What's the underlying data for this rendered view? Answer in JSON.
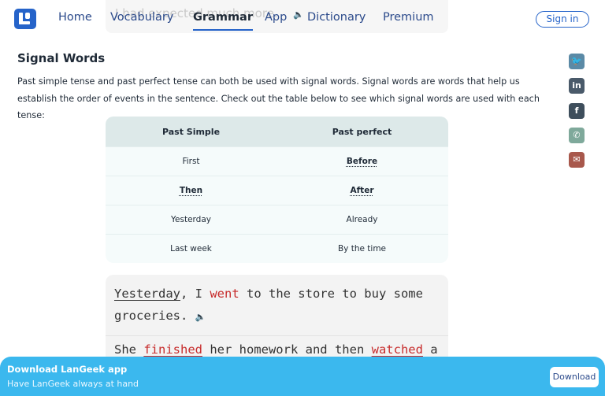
{
  "header": {
    "nav": [
      "Home",
      "Vocabulary",
      "Grammar",
      "App",
      "Dictionary",
      "Premium"
    ],
    "active": "Grammar",
    "faded_sentence": "I had expected much more.",
    "signin": "Sign in"
  },
  "section": {
    "title": "Signal Words",
    "paragraph": "Past simple tense and past perfect tense can both be used with signal words. Signal words are words that help us establish the order of events in the sentence. Check out the table below to see which signal words are used with each tense:"
  },
  "table": {
    "headers": [
      "Past Simple",
      "Past perfect"
    ],
    "rows": [
      [
        "First",
        "Before"
      ],
      [
        "Then",
        "After"
      ],
      [
        "Yesterday",
        "Already"
      ],
      [
        "Last week",
        "By the time"
      ]
    ]
  },
  "example": {
    "s1_w1": "Yesterday",
    "s1_w2": ", I ",
    "s1_w3": "went",
    "s1_w4": " to the store to buy some groceries.",
    "s2_w1": "She ",
    "s2_w2": "finished",
    "s2_w3": " her homework and then ",
    "s2_w4": "watched",
    "s2_w5": " a"
  },
  "share": [
    "twitter-icon",
    "linkedin-icon",
    "facebook-icon",
    "whatsapp-icon",
    "email-icon"
  ],
  "banner": {
    "title": "Download LanGeek app",
    "subtitle": "Have LanGeek always at hand",
    "button": "Download"
  },
  "colors": {
    "brand": "#2563c9",
    "banner": "#3bb8ee",
    "highlight": "#c72c2c"
  }
}
